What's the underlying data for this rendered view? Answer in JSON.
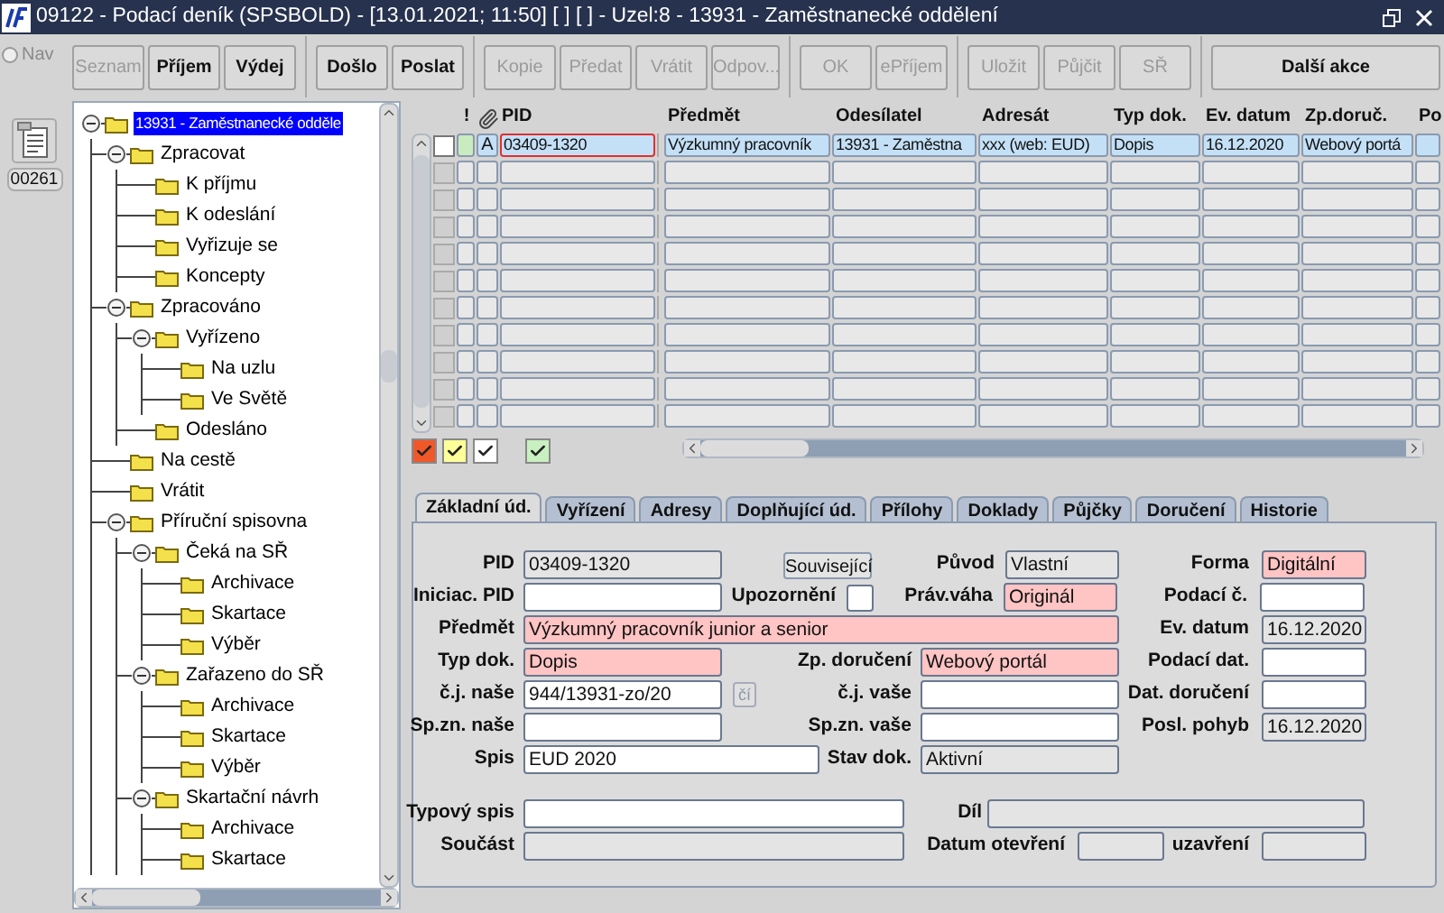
{
  "window": {
    "title": "09122 - Podací deník (SPSBOLD) - [13.01.2021; 11:50] [ ] [ ] - Uzel:8 - 13931 - Zaměstnanecké oddělení"
  },
  "nav": {
    "label": "Nav",
    "selected": false,
    "counter": "00261"
  },
  "toolbar": {
    "groups": [
      {
        "buttons": [
          {
            "label": "Seznam",
            "disabled": true
          },
          {
            "label": "Příjem",
            "disabled": false
          },
          {
            "label": "Výdej",
            "disabled": false
          }
        ]
      },
      {
        "buttons": [
          {
            "label": "Došlo",
            "disabled": false
          },
          {
            "label": "Poslat",
            "disabled": false
          }
        ]
      },
      {
        "buttons": [
          {
            "label": "Kopie",
            "disabled": true
          },
          {
            "label": "Předat",
            "disabled": true
          },
          {
            "label": "Vrátit",
            "disabled": true
          },
          {
            "label": "Odpov...",
            "disabled": true
          }
        ]
      },
      {
        "buttons": [
          {
            "label": "OK",
            "disabled": true
          },
          {
            "label": "ePříjem",
            "disabled": true
          }
        ]
      },
      {
        "buttons": [
          {
            "label": "Uložit",
            "disabled": true
          },
          {
            "label": "Půjčit",
            "disabled": true
          },
          {
            "label": "SŘ",
            "disabled": true
          }
        ]
      },
      {
        "buttons": [
          {
            "label": "Další akce",
            "disabled": false
          }
        ]
      }
    ]
  },
  "tree": {
    "label": "13931 - Zaměstnanecké odděle",
    "selected": true,
    "expanded": true,
    "children": [
      {
        "label": "Zpracovat",
        "selected": false,
        "expanded": true,
        "children": [
          {
            "label": "K příjmu",
            "selected": false
          },
          {
            "label": "K odeslání",
            "selected": false
          },
          {
            "label": "Vyřizuje se",
            "selected": false
          },
          {
            "label": "Koncepty",
            "selected": false
          }
        ]
      },
      {
        "label": "Zpracováno",
        "selected": false,
        "expanded": true,
        "children": [
          {
            "label": "Vyřízeno",
            "selected": false,
            "expanded": true,
            "children": [
              {
                "label": "Na uzlu",
                "selected": false
              },
              {
                "label": "Ve Světě",
                "selected": false
              }
            ]
          },
          {
            "label": "Odesláno",
            "selected": false
          }
        ]
      },
      {
        "label": "Na cestě",
        "selected": false
      },
      {
        "label": "Vrátit",
        "selected": false
      },
      {
        "label": "Příruční spisovna",
        "selected": false,
        "expanded": true,
        "children": [
          {
            "label": "Čeká na SŘ",
            "selected": false,
            "expanded": true,
            "children": [
              {
                "label": "Archivace",
                "selected": false
              },
              {
                "label": "Skartace",
                "selected": false
              },
              {
                "label": "Výběr",
                "selected": false
              }
            ]
          },
          {
            "label": "Zařazeno do SŘ",
            "selected": false,
            "expanded": true,
            "children": [
              {
                "label": "Archivace",
                "selected": false
              },
              {
                "label": "Skartace",
                "selected": false
              },
              {
                "label": "Výběr",
                "selected": false
              }
            ]
          },
          {
            "label": "Skartační návrh",
            "selected": false,
            "expanded": true,
            "children": [
              {
                "label": "Archivace",
                "selected": false
              },
              {
                "label": "Skartace",
                "selected": false
              }
            ]
          }
        ]
      }
    ]
  },
  "table": {
    "columns": [
      "!",
      "PID",
      "Předmět",
      "Odesílatel",
      "Adresát",
      "Typ dok.",
      "Ev. datum",
      "Zp.doruč.",
      "Po"
    ],
    "rows": [
      {
        "selected": true,
        "checked": false,
        "focused": true,
        "color": "#c8ecc0",
        "mark": "A",
        "cells": [
          "03409-1320",
          "Výzkumný pracovník",
          "13931 - Zaměstna",
          "xxx (web: EUD)",
          "Dopis",
          "16.12.2020",
          "Webový portá"
        ]
      },
      {
        "selected": false
      },
      {
        "selected": false
      },
      {
        "selected": false
      },
      {
        "selected": false
      },
      {
        "selected": false
      },
      {
        "selected": false
      },
      {
        "selected": false
      },
      {
        "selected": false
      },
      {
        "selected": false
      },
      {
        "selected": false
      }
    ]
  },
  "filters": [
    {
      "color": "#f0582a",
      "checked": true
    },
    {
      "color": "#ffff99",
      "checked": true
    },
    {
      "color": "#ffffff",
      "checked": true
    },
    {
      "color": "#c8f0c0",
      "checked": true
    }
  ],
  "tabs": [
    {
      "label": "Základní úd.",
      "selected": true
    },
    {
      "label": "Vyřízení",
      "selected": false
    },
    {
      "label": "Adresy",
      "selected": false
    },
    {
      "label": "Doplňující úd.",
      "selected": false
    },
    {
      "label": "Přílohy",
      "selected": false
    },
    {
      "label": "Doklady",
      "selected": false
    },
    {
      "label": "Půjčky",
      "selected": false
    },
    {
      "label": "Doručení",
      "selected": false
    },
    {
      "label": "Historie",
      "selected": false
    }
  ],
  "form": {
    "pid": {
      "label": "PID",
      "value": "03409-1320",
      "kind": "readonly"
    },
    "related_button": "Související",
    "puvod": {
      "label": "Původ",
      "value": "Vlastní",
      "kind": "readonly"
    },
    "forma": {
      "label": "Forma",
      "value": "Digitální",
      "kind": "required"
    },
    "iniciac_pid": {
      "label": "Iniciac. PID",
      "kind": "normal"
    },
    "upozorneni": {
      "label": "Upozornění",
      "checked": false
    },
    "prav_vaha": {
      "label": "Práv.váha",
      "value": "Originál",
      "kind": "required"
    },
    "podaci_c": {
      "label": "Podací č.",
      "kind": "normal"
    },
    "predmet": {
      "label": "Předmět",
      "value": "Výzkumný pracovník junior a senior",
      "kind": "required"
    },
    "ev_datum": {
      "label": "Ev. datum",
      "value": "16.12.2020",
      "kind": "readonly"
    },
    "typ_dok": {
      "label": "Typ dok.",
      "value": "Dopis",
      "kind": "required"
    },
    "zp_doruceni": {
      "label": "Zp. doručení",
      "value": "Webový portál",
      "kind": "required"
    },
    "podaci_dat": {
      "label": "Podací dat.",
      "kind": "normal"
    },
    "cj_nase": {
      "label": "č.j. naše",
      "value": "944/13931-zo/20",
      "kind": "normal"
    },
    "cj_button": {
      "label": "čí",
      "disabled": true
    },
    "cj_vase": {
      "label": "č.j. vaše",
      "kind": "normal"
    },
    "dat_doruceni": {
      "label": "Dat. doručení",
      "kind": "normal"
    },
    "spzn_nase": {
      "label": "Sp.zn. naše",
      "kind": "normal"
    },
    "spzn_vase": {
      "label": "Sp.zn. vaše",
      "kind": "normal"
    },
    "posl_pohyb": {
      "label": "Posl. pohyb",
      "value": "16.12.2020",
      "kind": "readonly"
    },
    "spis": {
      "label": "Spis",
      "value": "EUD 2020",
      "kind": "normal"
    },
    "stav_dok": {
      "label": "Stav dok.",
      "value": "Aktivní",
      "kind": "readonly"
    },
    "typovy_spis": {
      "label": "Typový spis",
      "kind": "normal"
    },
    "dil": {
      "label": "Díl",
      "kind": "readonly"
    },
    "soucast": {
      "label": "Součást",
      "kind": "readonly"
    },
    "datum_otevreni": {
      "label": "Datum otevření",
      "kind": "readonly"
    },
    "uzavreni": {
      "label": "uzavření",
      "kind": "readonly"
    }
  }
}
